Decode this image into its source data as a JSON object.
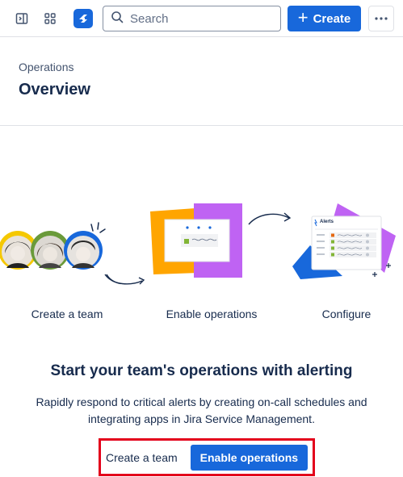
{
  "topbar": {
    "search_placeholder": "Search",
    "create_label": "Create",
    "icons": [
      "sidebar-toggle-icon",
      "app-switcher-icon",
      "product-logo-icon",
      "search-icon",
      "plus-icon",
      "more-icon"
    ]
  },
  "header": {
    "breadcrumb": "Operations",
    "title": "Overview"
  },
  "steps": [
    {
      "label": "Create a team"
    },
    {
      "label": "Enable operations"
    },
    {
      "label": "Configure"
    }
  ],
  "illustration_text": {
    "alerts": "Alerts"
  },
  "main": {
    "headline": "Start your team's operations with alerting",
    "description": "Rapidly respond to critical alerts by creating on-call schedules and integrating apps in Jira Service Management."
  },
  "actions": {
    "secondary_label": "Create a team",
    "primary_label": "Enable operations"
  },
  "colors": {
    "brand_blue": "#1868db",
    "highlight_red": "#e3001b",
    "illus_orange": "#ffa500",
    "illus_purple": "#bf63f3"
  }
}
